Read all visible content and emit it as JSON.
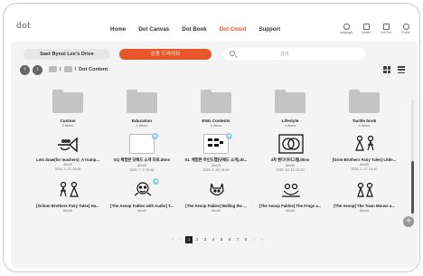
{
  "header": {
    "logo": "dot",
    "nav": [
      "Home",
      "Dot Canvas",
      "Dot Book",
      "Dot Cloud",
      "Support"
    ],
    "active_nav": "Dot Cloud",
    "icons": [
      {
        "name": "language-icon",
        "label": "Language"
      },
      {
        "name": "mobile-icon",
        "label": "Mobile"
      },
      {
        "name": "dot-pad-icon",
        "label": "Dot Pad"
      },
      {
        "name": "profile-icon",
        "label": "Profile"
      }
    ]
  },
  "toolbar": {
    "my_drive": "Saet Byeol Lee's Drive",
    "shared_drive": "공동 드라이브",
    "search_placeholder": "검색"
  },
  "breadcrumb": {
    "root": "/",
    "sep": "/",
    "current": "Dot Content"
  },
  "folders": [
    {
      "name": "Custom",
      "count": "3 Items"
    },
    {
      "name": "Education",
      "count": "2 Items"
    },
    {
      "name": "ENG Contents",
      "count": "3 Items"
    },
    {
      "name": "Lifestyle",
      "count": "4 Items"
    },
    {
      "name": "Tactile book",
      "count": "4 Items"
    }
  ],
  "files_row1": [
    {
      "name": "Lets draw(for teachers)_A trump...",
      "size": "60x40",
      "date": "2024. 2. 23. 00:00",
      "badge": false
    },
    {
      "name": "01) 체험판 닷패드 소개 자료.dtms",
      "size": "60x40",
      "date": "2023. 7. 2. 00:32",
      "badge": true
    },
    {
      "name": "01. 체험판 마인드맵(닷패드 소개).dt...",
      "size": "60x40",
      "date": "2023. 6. 30. 04:00",
      "badge": true
    },
    {
      "name": "3차 벤다이어그램.dtms",
      "size": "60x40",
      "date": "2023. 10. 13. 01:00",
      "badge": false
    },
    {
      "name": "[Grim Brothers Fairy Tales] Little...",
      "size": "60x40",
      "date": "2023. 1. 27. 01:40",
      "badge": false
    }
  ],
  "files_row2": [
    {
      "name": "[Grimm Brothers Fairy Tales] Ha...",
      "size": "60x40",
      "badge": false
    },
    {
      "name": "[The Aesop Fables with Audio] T...",
      "size": "60x40",
      "badge": true
    },
    {
      "name": "[The Aesop Fables] Belling the ...",
      "size": "60x40",
      "badge": false
    },
    {
      "name": "[The Aesop Fables] The Frogs a...",
      "size": "60x40",
      "badge": false
    },
    {
      "name": "[The Aesop] The Town Mouse a...",
      "size": "60x40",
      "badge": false
    }
  ],
  "pagination": {
    "pages": [
      "1",
      "2",
      "3",
      "4",
      "5",
      "6",
      "7",
      "8"
    ],
    "current": "1",
    "first": "«",
    "prev": "‹",
    "next": "›",
    "last": "»"
  },
  "badge_glyph": "◀)",
  "fab": "+"
}
